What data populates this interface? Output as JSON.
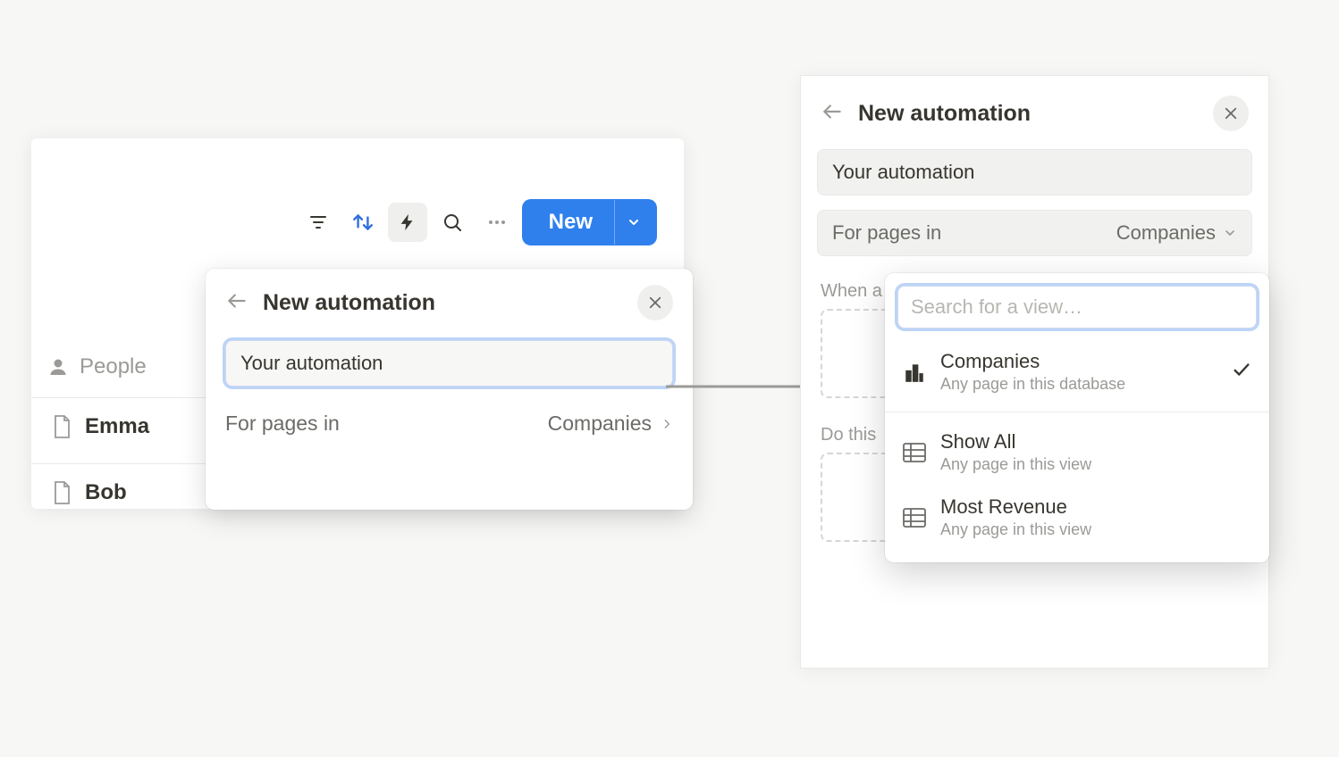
{
  "left": {
    "toolbar": {
      "new_label": "New"
    },
    "column_header": "People",
    "pages": [
      "Emma",
      "Bob"
    ],
    "popover": {
      "title": "New automation",
      "name_value": "Your automation",
      "for_label": "For pages in",
      "for_value": "Companies"
    }
  },
  "right": {
    "title": "New automation",
    "name_value": "Your automation",
    "for_label": "For pages in",
    "for_value": "Companies",
    "section_when": "When a",
    "section_do": "Do this",
    "dropdown": {
      "search_placeholder": "Search for a view…",
      "items": [
        {
          "title": "Companies",
          "subtitle": "Any page in this database",
          "icon": "building",
          "selected": true
        },
        {
          "title": "Show All",
          "subtitle": "Any page in this view",
          "icon": "table",
          "selected": false
        },
        {
          "title": "Most Revenue",
          "subtitle": "Any page in this view",
          "icon": "table",
          "selected": false
        }
      ]
    }
  }
}
